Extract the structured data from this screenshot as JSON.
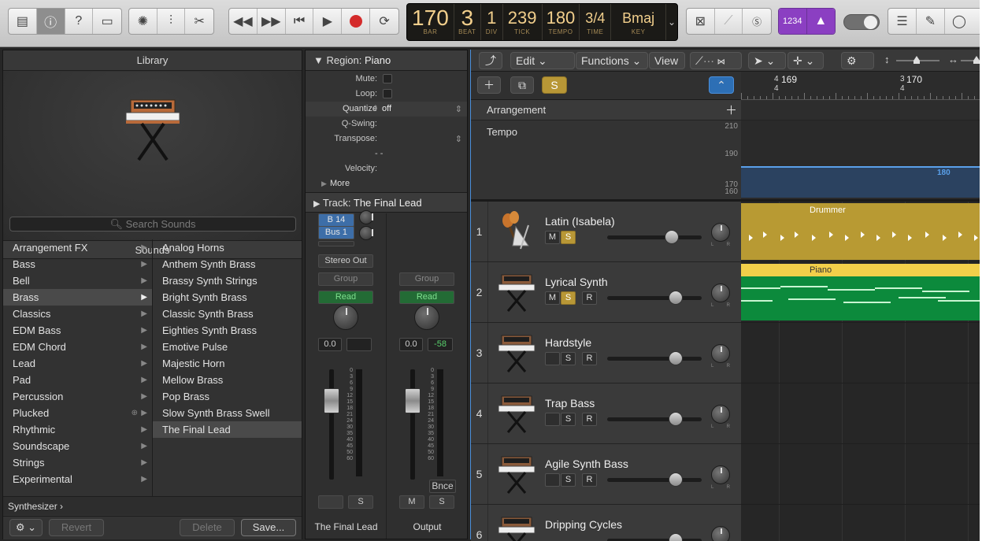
{
  "control_bar": {
    "lcd": {
      "bar": "170",
      "bar_label": "BAR",
      "beat": "3",
      "beat_label": "BEAT",
      "div": "1",
      "div_label": "DIV",
      "tick": "239",
      "tick_label": "TICK",
      "tempo": "180",
      "tempo_label": "TEMPO",
      "time_num": "3",
      "time_den": "4",
      "time_label": "TIME",
      "key": "Bmaj",
      "key_label": "KEY"
    },
    "count_in_label": "1234",
    "icons": [
      "library-icon",
      "info-icon",
      "help-icon",
      "editors-icon",
      "smart-controls-icon",
      "mixer-icon",
      "scissors-icon",
      "rewind-icon",
      "forward-icon",
      "go-to-start-icon",
      "play-icon",
      "record-icon",
      "cycle-icon",
      "replace-icon",
      "tuner-icon",
      "solo-icon",
      "metronome-icon",
      "list-editors-icon",
      "note-pad-icon",
      "loop-browser-icon"
    ]
  },
  "library": {
    "title": "Library",
    "patch_name": "The Final Lead",
    "sounds_header": "Sounds",
    "search_placeholder": "Search Sounds",
    "categories": [
      {
        "label": "Arrangement FX"
      },
      {
        "label": "Bass"
      },
      {
        "label": "Bell"
      },
      {
        "label": "Brass"
      },
      {
        "label": "Classics"
      },
      {
        "label": "EDM Bass"
      },
      {
        "label": "EDM Chord"
      },
      {
        "label": "Lead"
      },
      {
        "label": "Pad"
      },
      {
        "label": "Percussion"
      },
      {
        "label": "Plucked"
      },
      {
        "label": "Rhythmic"
      },
      {
        "label": "Soundscape"
      },
      {
        "label": "Strings"
      },
      {
        "label": "Experimental"
      }
    ],
    "patches": [
      {
        "label": "Analog Horns"
      },
      {
        "label": "Anthem Synth Brass"
      },
      {
        "label": "Brassy Synth Strings"
      },
      {
        "label": "Bright Synth Brass"
      },
      {
        "label": "Classic Synth Brass"
      },
      {
        "label": "Eighties Synth Brass"
      },
      {
        "label": "Emotive Pulse"
      },
      {
        "label": "Majestic Horn"
      },
      {
        "label": "Mellow Brass"
      },
      {
        "label": "Pop Brass"
      },
      {
        "label": "Slow Synth Brass Swell"
      },
      {
        "label": "The Final Lead"
      }
    ],
    "selected_category": "Brass",
    "selected_patch": "The Final Lead",
    "footer_path": "Synthesizer",
    "revert_label": "Revert",
    "delete_label": "Delete",
    "save_label": "Save..."
  },
  "inspector": {
    "region_header": "Region:",
    "region_name": "Piano",
    "mute_label": "Mute:",
    "loop_label": "Loop:",
    "quantize_label": "Quantize",
    "quantize_value": "off",
    "qswing_label": "Q-Swing:",
    "transpose_label": "Transpose:",
    "velocity_label": "Velocity:",
    "dash": "- -",
    "more_label": "More",
    "track_header": "Track:",
    "track_name": "The Final Lead",
    "strip1": {
      "send_b14": "B 14",
      "send_bus1": "Bus 1",
      "output": "Stereo Out",
      "group": "Group",
      "automation": "Read",
      "volume": "0.0",
      "solo": "S",
      "name": "The Final Lead"
    },
    "strip2": {
      "group": "Group",
      "automation": "Read",
      "volume": "0.0",
      "peak": "-58",
      "bounce": "Bnce",
      "mute": "M",
      "solo": "S",
      "name": "Output"
    },
    "fader_scale": [
      "0",
      "3",
      "6",
      "9",
      "12",
      "15",
      "18",
      "21",
      "24",
      "30",
      "35",
      "40",
      "45",
      "50",
      "60"
    ]
  },
  "tracks_area": {
    "menu": {
      "edit": "Edit",
      "functions": "Functions",
      "view": "View"
    },
    "solo_label": "S",
    "ruler": {
      "bar1": "169",
      "bar2": "170",
      "sig1_top": "4",
      "sig1_bottom": "4",
      "sig2_top": "3",
      "sig2_bottom": "4"
    },
    "arrangement_label": "Arrangement",
    "tempo_label": "Tempo",
    "tempo_scale": [
      "210",
      "190",
      "170",
      "160"
    ],
    "tempo_value": "180",
    "tracks": [
      {
        "num": "1",
        "name": "Latin (Isabela)",
        "m": "M",
        "s": "S",
        "s_on": true,
        "r": "",
        "vol": 0.73,
        "icon": "percussion-icon"
      },
      {
        "num": "2",
        "name": "Lyrical Synth",
        "m": "M",
        "s": "S",
        "s_on": true,
        "r": "R",
        "vol": 0.78,
        "icon": "synth-keyboard-icon"
      },
      {
        "num": "3",
        "name": "Hardstyle",
        "m": "",
        "s": "S",
        "s_on": false,
        "r": "R",
        "vol": 0.78,
        "icon": "synth-keyboard-icon"
      },
      {
        "num": "4",
        "name": "Trap Bass",
        "m": "",
        "s": "S",
        "s_on": false,
        "r": "R",
        "vol": 0.78,
        "icon": "synth-keyboard-icon"
      },
      {
        "num": "5",
        "name": "Agile Synth Bass",
        "m": "",
        "s": "S",
        "s_on": false,
        "r": "R",
        "vol": 0.78,
        "icon": "synth-keyboard-icon"
      },
      {
        "num": "6",
        "name": "Dripping Cycles",
        "m": "",
        "s": "",
        "s_on": false,
        "r": "",
        "vol": 0.78,
        "icon": "synth-keyboard-icon"
      }
    ],
    "regions": {
      "drummer": {
        "label": "Drummer",
        "color": "#b89a33"
      },
      "piano": {
        "label": "Piano",
        "color": "#f2cf4a",
        "body": "#0c8a3c"
      }
    }
  },
  "colors": {
    "accent_blue": "#4b8fda",
    "solo_yellow": "#b89736",
    "count_in_purple": "#8b3fc2",
    "automation_green": "#58d06c",
    "lcd_text": "#f2cf8c"
  }
}
